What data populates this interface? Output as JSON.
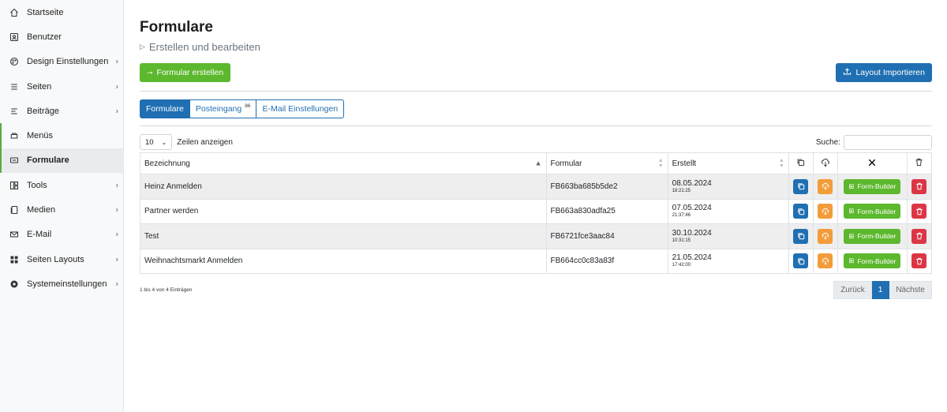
{
  "sidebar": {
    "items": [
      {
        "label": "Startseite",
        "icon": "home-icon",
        "chevron": false
      },
      {
        "label": "Benutzer",
        "icon": "user-icon",
        "chevron": false
      },
      {
        "label": "Design Einstellungen",
        "icon": "palette-icon",
        "chevron": true
      },
      {
        "label": "Seiten",
        "icon": "list-icon",
        "chevron": true
      },
      {
        "label": "Beiträge",
        "icon": "list-alt-icon",
        "chevron": true
      },
      {
        "label": "Menüs",
        "icon": "menu-icon",
        "chevron": false
      },
      {
        "label": "Formulare",
        "icon": "form-icon",
        "chevron": false
      },
      {
        "label": "Tools",
        "icon": "tools-icon",
        "chevron": true
      },
      {
        "label": "Medien",
        "icon": "media-icon",
        "chevron": true
      },
      {
        "label": "E-Mail",
        "icon": "mail-icon",
        "chevron": true
      },
      {
        "label": "Seiten Layouts",
        "icon": "grid-icon",
        "chevron": true
      },
      {
        "label": "Systemeinstellungen",
        "icon": "settings-icon",
        "chevron": true
      }
    ]
  },
  "header": {
    "title": "Formulare",
    "subtitle": "Erstellen und bearbeiten"
  },
  "toolbar": {
    "create_label": "Formular erstellen",
    "import_label": "Layout Importieren"
  },
  "tabs": [
    {
      "label": "Formulare",
      "badge": ""
    },
    {
      "label": "Posteingang",
      "badge": "86"
    },
    {
      "label": "E-Mail Einstellungen",
      "badge": ""
    }
  ],
  "table_controls": {
    "length_value": "10",
    "length_label": "Zeilen anzeigen",
    "search_label": "Suche:",
    "search_value": ""
  },
  "table": {
    "headers": {
      "name": "Bezeichnung",
      "form": "Formular",
      "created": "Erstellt"
    },
    "rows": [
      {
        "name": "Heinz Anmelden",
        "form": "FB663ba685b5de2",
        "date": "08.05.2024",
        "time": "18:21:25"
      },
      {
        "name": "Partner werden",
        "form": "FB663a830adfa25",
        "date": "07.05.2024",
        "time": "21:37:46"
      },
      {
        "name": "Test",
        "form": "FB6721fce3aac84",
        "date": "30.10.2024",
        "time": "10:31:15"
      },
      {
        "name": "Weihnachtsmarkt Anmelden",
        "form": "FB664cc0c83a83f",
        "date": "21.05.2024",
        "time": "17:42:00"
      }
    ],
    "form_builder_label": "Form-Builder"
  },
  "footer": {
    "info": "1 bis 4 von 4 Einträgen",
    "prev": "Zurück",
    "page": "1",
    "next": "Nächste"
  },
  "colors": {
    "primary": "#1f6fb2",
    "success": "#5cb82d",
    "warning": "#f39c3a",
    "danger": "#dc3545"
  }
}
